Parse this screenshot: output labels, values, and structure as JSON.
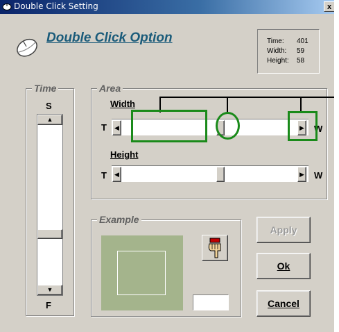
{
  "window": {
    "title": "Double Click Setting",
    "close_glyph": "x"
  },
  "header": {
    "title": "Double Click Option",
    "icon": "mouse-icon"
  },
  "info": {
    "time_label": "Time:",
    "time_value": "401",
    "width_label": "Width:",
    "width_value": "59",
    "height_label": "Height:",
    "height_value": "58"
  },
  "time_group": {
    "label": "Time",
    "top_label": "S",
    "bottom_label": "F"
  },
  "area_group": {
    "label": "Area",
    "width_label": "Width",
    "height_label": "Height",
    "left_end": "T",
    "right_end": "W"
  },
  "example_group": {
    "label": "Example",
    "hand_icon": "pointing-hand-icon"
  },
  "buttons": {
    "apply": "Apply",
    "ok": "Ok",
    "cancel": "Cancel"
  },
  "colors": {
    "accent_title": "#1a5b7a",
    "annotation_green": "#1a8a1a",
    "example_bg": "#a4b48c"
  }
}
